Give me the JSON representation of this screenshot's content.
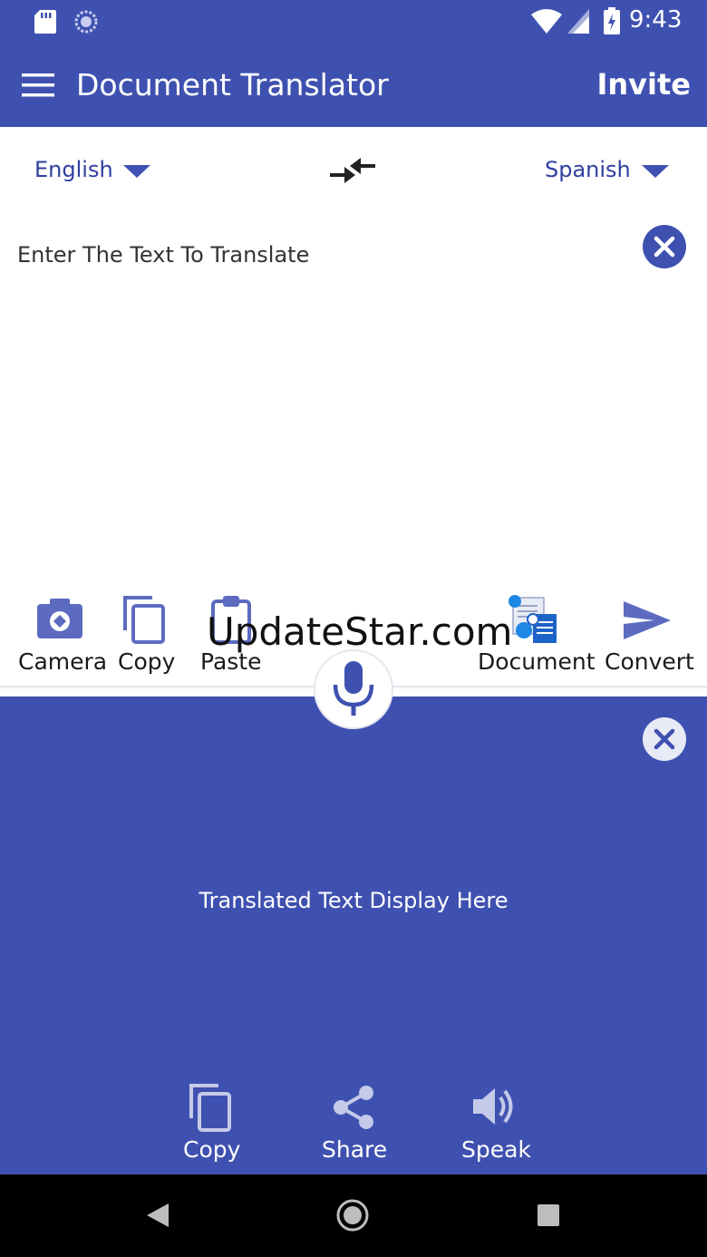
{
  "status_bar": {
    "time": "9:43"
  },
  "app_bar": {
    "title": "Document Translator",
    "invite_label": "Invite"
  },
  "languages": {
    "source": "English",
    "target": "Spanish"
  },
  "input": {
    "placeholder": "Enter The Text To Translate"
  },
  "input_toolbar": {
    "camera": "Camera",
    "copy": "Copy",
    "paste": "Paste",
    "document": "Document",
    "convert": "Convert"
  },
  "watermark": "UpdateStar.com",
  "output": {
    "placeholder": "Translated Text Display Here"
  },
  "output_toolbar": {
    "copy": "Copy",
    "share": "Share",
    "speak": "Speak"
  },
  "colors": {
    "primary": "#3f51b0",
    "accent_text": "#2f3fa0"
  }
}
